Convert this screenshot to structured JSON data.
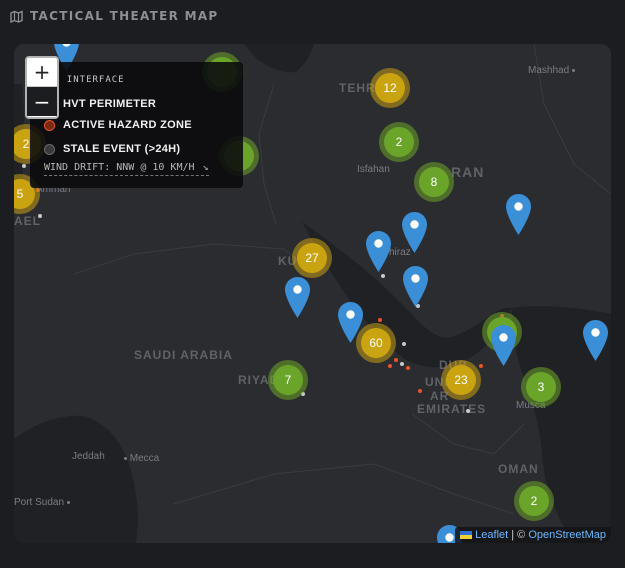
{
  "panel": {
    "title": "TACTICAL THEATER MAP",
    "icon": "map-icon"
  },
  "map": {
    "zoom_in_label": "+",
    "zoom_out_label": "−",
    "places": [
      {
        "id": "mashhad",
        "label": "Mashhad"
      },
      {
        "id": "tehran",
        "label": "TEHR"
      },
      {
        "id": "isfahan",
        "label": "Isfahan"
      },
      {
        "id": "iran",
        "label": "RAN"
      },
      {
        "id": "shiraz",
        "label": "hiraz"
      },
      {
        "id": "kuwait",
        "label": "KU"
      },
      {
        "id": "saudi",
        "label": "SAUDI ARABIA"
      },
      {
        "id": "riyadh",
        "label": "RIYAD"
      },
      {
        "id": "uae1",
        "label": "DUB"
      },
      {
        "id": "uae2",
        "label": "UNI"
      },
      {
        "id": "uae3",
        "label": "AR"
      },
      {
        "id": "uae4",
        "label": "EMIRATES"
      },
      {
        "id": "muscat",
        "label": "Musca"
      },
      {
        "id": "oman",
        "label": "OMAN"
      },
      {
        "id": "jeddah",
        "label": "Jeddah"
      },
      {
        "id": "mecca",
        "label": "Mecca"
      },
      {
        "id": "portsudan",
        "label": "Port Sudan"
      },
      {
        "id": "amman",
        "label": "Amman"
      },
      {
        "id": "israel",
        "label": "AEL"
      }
    ],
    "clusters": [
      {
        "id": "c-12",
        "count": "12",
        "color": "yellow"
      },
      {
        "id": "c-2a",
        "count": "2",
        "color": "green"
      },
      {
        "id": "c-8",
        "count": "8",
        "color": "green"
      },
      {
        "id": "c-27",
        "count": "27",
        "color": "yellow"
      },
      {
        "id": "c-60",
        "count": "60",
        "color": "yellow"
      },
      {
        "id": "c-23",
        "count": "23",
        "color": "yellow"
      },
      {
        "id": "c-7",
        "count": "7",
        "color": "green"
      },
      {
        "id": "c-3",
        "count": "3",
        "color": "green"
      },
      {
        "id": "c-2b",
        "count": "2",
        "color": "green"
      },
      {
        "id": "c-2left",
        "count": "2",
        "color": "yellow"
      },
      {
        "id": "c-5left",
        "count": "5",
        "color": "yellow"
      }
    ],
    "legend": {
      "title": "P INTERFACE",
      "items": [
        {
          "label": "HVT PERIMETER",
          "color": "#e0b020"
        },
        {
          "label": "ACTIVE HAZARD ZONE",
          "color": "#e8552a"
        },
        {
          "label": "STALE EVENT (>24H)",
          "color": "#6b6b6b"
        }
      ],
      "wind": "WIND DRIFT: NNW @ 10 KM/H",
      "wind_icon": "arrow-down-right-icon"
    },
    "attribution": {
      "leaflet": "Leaflet",
      "sep": "|",
      "copy": "©",
      "osm": "OpenStreetMap"
    }
  }
}
